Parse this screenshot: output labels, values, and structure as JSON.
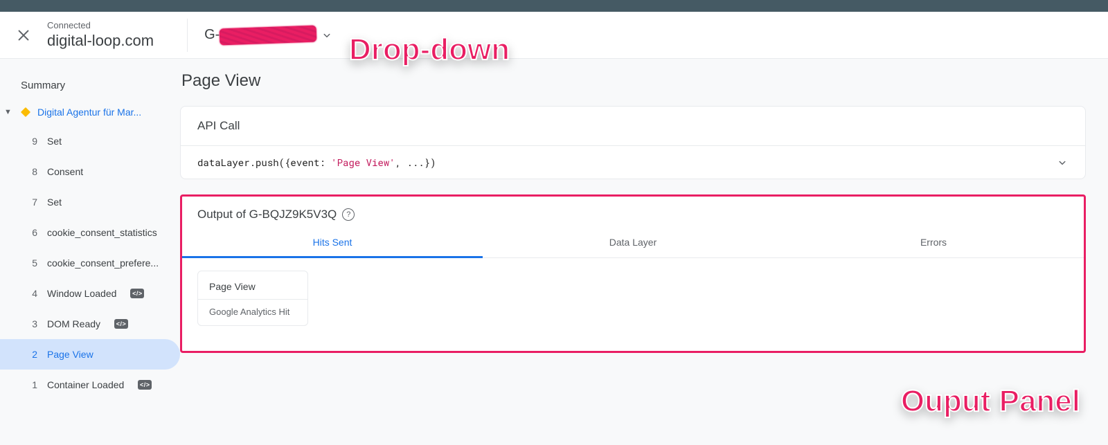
{
  "header": {
    "connected_label": "Connected",
    "domain": "digital-loop.com",
    "account_prefix": "G-",
    "account_redacted": true
  },
  "annotations": {
    "dropdown": "Drop-down",
    "output_panel": "Ouput Panel"
  },
  "sidebar": {
    "summary_label": "Summary",
    "group_label": "Digital Agentur für Mar...",
    "events": [
      {
        "n": "9",
        "label": "Set",
        "code_chip": false,
        "active": false
      },
      {
        "n": "8",
        "label": "Consent",
        "code_chip": false,
        "active": false
      },
      {
        "n": "7",
        "label": "Set",
        "code_chip": false,
        "active": false
      },
      {
        "n": "6",
        "label": "cookie_consent_statistics",
        "code_chip": false,
        "active": false
      },
      {
        "n": "5",
        "label": "cookie_consent_prefere...",
        "code_chip": false,
        "active": false
      },
      {
        "n": "4",
        "label": "Window Loaded",
        "code_chip": true,
        "active": false
      },
      {
        "n": "3",
        "label": "DOM Ready",
        "code_chip": true,
        "active": false
      },
      {
        "n": "2",
        "label": "Page View",
        "code_chip": false,
        "active": true
      },
      {
        "n": "1",
        "label": "Container Loaded",
        "code_chip": true,
        "active": false
      }
    ]
  },
  "main": {
    "title": "Page View",
    "api_call": {
      "heading": "API Call",
      "code_prefix": "dataLayer.push({event: ",
      "code_string": "'Page View'",
      "code_suffix": ", ...})"
    },
    "output": {
      "heading": "Output of G-BQJZ9K5V3Q",
      "tabs": [
        "Hits Sent",
        "Data Layer",
        "Errors"
      ],
      "active_tab_index": 0,
      "hits": [
        {
          "name": "Page View",
          "desc": "Google Analytics Hit"
        }
      ]
    }
  },
  "colors": {
    "pink": "#e91e63",
    "blue": "#1a73e8"
  }
}
